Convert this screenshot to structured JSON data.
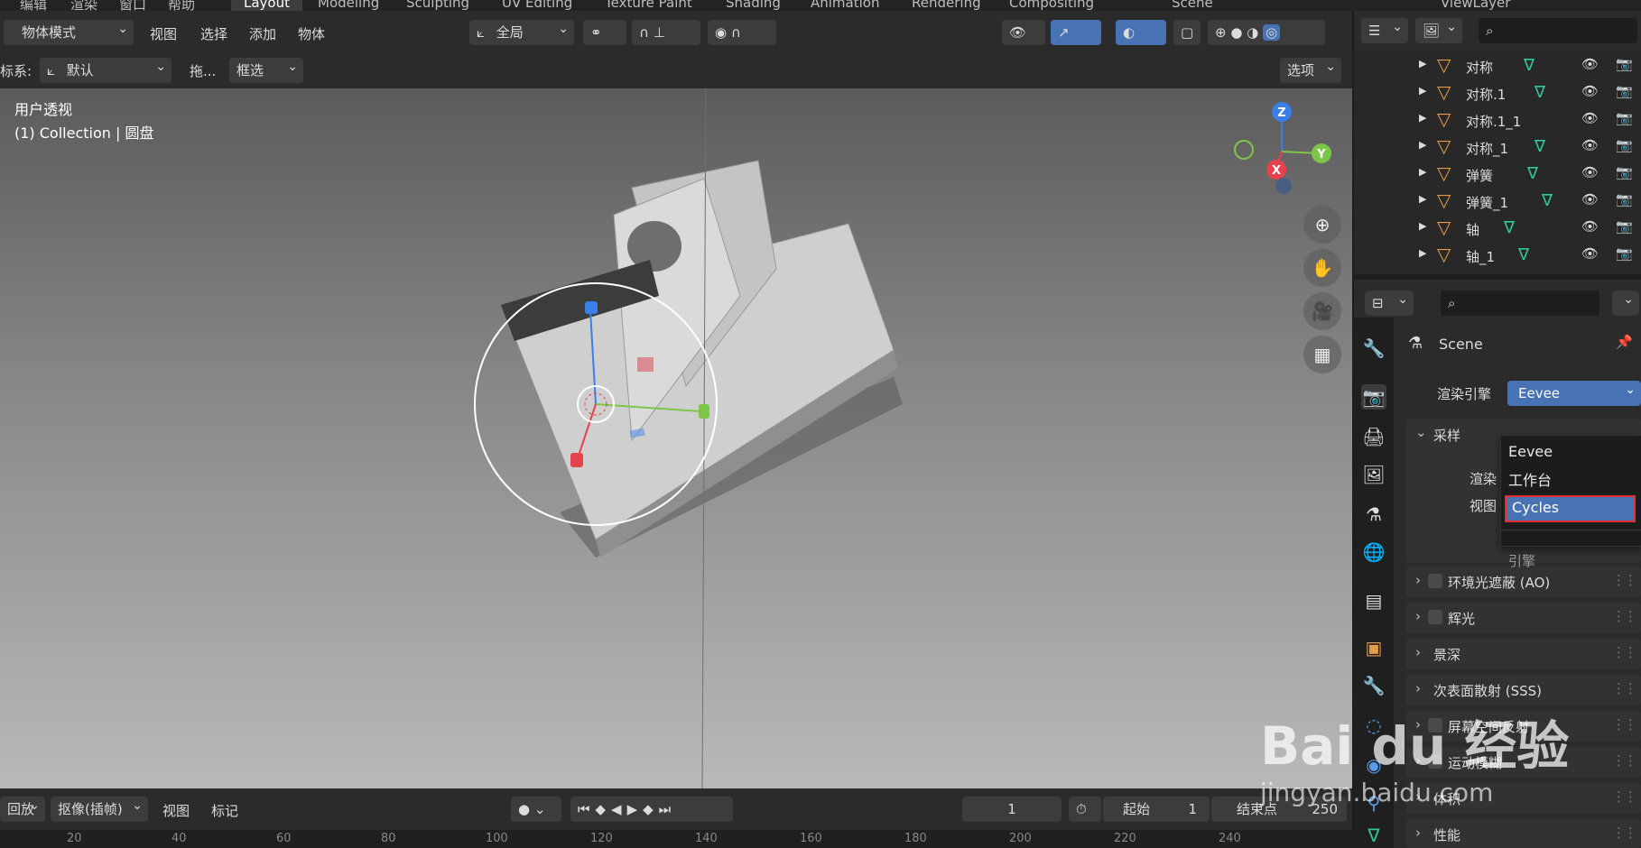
{
  "top_tabs": [
    "编辑",
    "渲染",
    "窗口",
    "帮助",
    "Layout",
    "Modeling",
    "Sculpting",
    "UV Editing",
    "Texture Paint",
    "Shading",
    "Animation",
    "Rendering",
    "Compositing"
  ],
  "scene_name": "Scene",
  "view_layer": "ViewLayer",
  "viewport_header": {
    "mode": "物体模式",
    "menus": [
      "视图",
      "选择",
      "添加",
      "物体"
    ],
    "transform_orientation": "全局"
  },
  "tool_header": {
    "coord_label": "标系:",
    "coord_value": "默认",
    "drag_label": "拖...",
    "select_mode": "框选",
    "options": "选项"
  },
  "viewport": {
    "view_name": "用户透视",
    "collection": "(1) Collection | 圆盘",
    "gizmo": {
      "z": "Z",
      "y": "Y",
      "x": "X"
    }
  },
  "timeline": {
    "playback": "回放",
    "keying": "抠像(插帧)",
    "view": "视图",
    "marker": "标记",
    "current_frame": "1",
    "start_label": "起始",
    "start_value": "1",
    "end_label": "结束点",
    "end_value": "250",
    "ruler": [
      "20",
      "40",
      "60",
      "80",
      "100",
      "120",
      "140",
      "160",
      "180",
      "200",
      "220",
      "240"
    ]
  },
  "outliner": {
    "items": [
      "对称",
      "对称.1",
      "对称.1_1",
      "对称_1",
      "弹簧",
      "弹簧_1",
      "轴",
      "轴_1"
    ]
  },
  "properties": {
    "title": "Scene",
    "render_engine_label": "渲染引擎",
    "render_engine_value": "Eevee",
    "sampling": "采样",
    "render_label": "渲染",
    "viewport_label": "视图",
    "panels": [
      "环境光遮蔽 (AO)",
      "辉光",
      "景深",
      "次表面散射 (SSS)",
      "屏幕空间反射",
      "运动模糊",
      "体积",
      "性能"
    ]
  },
  "engine_dropdown": {
    "items": [
      "Eevee",
      "工作台",
      "Cycles"
    ],
    "selected": "Cycles",
    "footer": "引擎"
  },
  "watermark": {
    "brand": "Bai du 经验",
    "url": "jingyan.baidu.com"
  }
}
